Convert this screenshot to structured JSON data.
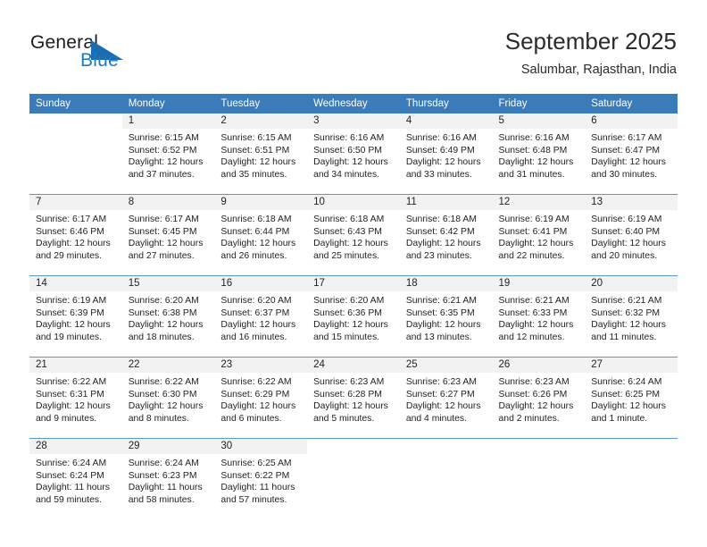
{
  "brand": {
    "word1": "General",
    "word2": "Blue",
    "accent_color": "#1b6cb3",
    "blue_text_color": "#1f7ac0"
  },
  "header": {
    "title": "September 2025",
    "subtitle": "Salumbar, Rajasthan, India"
  },
  "calendar": {
    "header_bg": "#3a7cba",
    "daynum_bg": "#f2f2f2",
    "weekday_headers": [
      "Sunday",
      "Monday",
      "Tuesday",
      "Wednesday",
      "Thursday",
      "Friday",
      "Saturday"
    ],
    "weeks": [
      [
        {
          "day": "",
          "sunrise": "",
          "sunset": "",
          "daylight1": "",
          "daylight2": ""
        },
        {
          "day": "1",
          "sunrise": "Sunrise: 6:15 AM",
          "sunset": "Sunset: 6:52 PM",
          "daylight1": "Daylight: 12 hours",
          "daylight2": "and 37 minutes."
        },
        {
          "day": "2",
          "sunrise": "Sunrise: 6:15 AM",
          "sunset": "Sunset: 6:51 PM",
          "daylight1": "Daylight: 12 hours",
          "daylight2": "and 35 minutes."
        },
        {
          "day": "3",
          "sunrise": "Sunrise: 6:16 AM",
          "sunset": "Sunset: 6:50 PM",
          "daylight1": "Daylight: 12 hours",
          "daylight2": "and 34 minutes."
        },
        {
          "day": "4",
          "sunrise": "Sunrise: 6:16 AM",
          "sunset": "Sunset: 6:49 PM",
          "daylight1": "Daylight: 12 hours",
          "daylight2": "and 33 minutes."
        },
        {
          "day": "5",
          "sunrise": "Sunrise: 6:16 AM",
          "sunset": "Sunset: 6:48 PM",
          "daylight1": "Daylight: 12 hours",
          "daylight2": "and 31 minutes."
        },
        {
          "day": "6",
          "sunrise": "Sunrise: 6:17 AM",
          "sunset": "Sunset: 6:47 PM",
          "daylight1": "Daylight: 12 hours",
          "daylight2": "and 30 minutes."
        }
      ],
      [
        {
          "day": "7",
          "sunrise": "Sunrise: 6:17 AM",
          "sunset": "Sunset: 6:46 PM",
          "daylight1": "Daylight: 12 hours",
          "daylight2": "and 29 minutes."
        },
        {
          "day": "8",
          "sunrise": "Sunrise: 6:17 AM",
          "sunset": "Sunset: 6:45 PM",
          "daylight1": "Daylight: 12 hours",
          "daylight2": "and 27 minutes."
        },
        {
          "day": "9",
          "sunrise": "Sunrise: 6:18 AM",
          "sunset": "Sunset: 6:44 PM",
          "daylight1": "Daylight: 12 hours",
          "daylight2": "and 26 minutes."
        },
        {
          "day": "10",
          "sunrise": "Sunrise: 6:18 AM",
          "sunset": "Sunset: 6:43 PM",
          "daylight1": "Daylight: 12 hours",
          "daylight2": "and 25 minutes."
        },
        {
          "day": "11",
          "sunrise": "Sunrise: 6:18 AM",
          "sunset": "Sunset: 6:42 PM",
          "daylight1": "Daylight: 12 hours",
          "daylight2": "and 23 minutes."
        },
        {
          "day": "12",
          "sunrise": "Sunrise: 6:19 AM",
          "sunset": "Sunset: 6:41 PM",
          "daylight1": "Daylight: 12 hours",
          "daylight2": "and 22 minutes."
        },
        {
          "day": "13",
          "sunrise": "Sunrise: 6:19 AM",
          "sunset": "Sunset: 6:40 PM",
          "daylight1": "Daylight: 12 hours",
          "daylight2": "and 20 minutes."
        }
      ],
      [
        {
          "day": "14",
          "sunrise": "Sunrise: 6:19 AM",
          "sunset": "Sunset: 6:39 PM",
          "daylight1": "Daylight: 12 hours",
          "daylight2": "and 19 minutes."
        },
        {
          "day": "15",
          "sunrise": "Sunrise: 6:20 AM",
          "sunset": "Sunset: 6:38 PM",
          "daylight1": "Daylight: 12 hours",
          "daylight2": "and 18 minutes."
        },
        {
          "day": "16",
          "sunrise": "Sunrise: 6:20 AM",
          "sunset": "Sunset: 6:37 PM",
          "daylight1": "Daylight: 12 hours",
          "daylight2": "and 16 minutes."
        },
        {
          "day": "17",
          "sunrise": "Sunrise: 6:20 AM",
          "sunset": "Sunset: 6:36 PM",
          "daylight1": "Daylight: 12 hours",
          "daylight2": "and 15 minutes."
        },
        {
          "day": "18",
          "sunrise": "Sunrise: 6:21 AM",
          "sunset": "Sunset: 6:35 PM",
          "daylight1": "Daylight: 12 hours",
          "daylight2": "and 13 minutes."
        },
        {
          "day": "19",
          "sunrise": "Sunrise: 6:21 AM",
          "sunset": "Sunset: 6:33 PM",
          "daylight1": "Daylight: 12 hours",
          "daylight2": "and 12 minutes."
        },
        {
          "day": "20",
          "sunrise": "Sunrise: 6:21 AM",
          "sunset": "Sunset: 6:32 PM",
          "daylight1": "Daylight: 12 hours",
          "daylight2": "and 11 minutes."
        }
      ],
      [
        {
          "day": "21",
          "sunrise": "Sunrise: 6:22 AM",
          "sunset": "Sunset: 6:31 PM",
          "daylight1": "Daylight: 12 hours",
          "daylight2": "and 9 minutes."
        },
        {
          "day": "22",
          "sunrise": "Sunrise: 6:22 AM",
          "sunset": "Sunset: 6:30 PM",
          "daylight1": "Daylight: 12 hours",
          "daylight2": "and 8 minutes."
        },
        {
          "day": "23",
          "sunrise": "Sunrise: 6:22 AM",
          "sunset": "Sunset: 6:29 PM",
          "daylight1": "Daylight: 12 hours",
          "daylight2": "and 6 minutes."
        },
        {
          "day": "24",
          "sunrise": "Sunrise: 6:23 AM",
          "sunset": "Sunset: 6:28 PM",
          "daylight1": "Daylight: 12 hours",
          "daylight2": "and 5 minutes."
        },
        {
          "day": "25",
          "sunrise": "Sunrise: 6:23 AM",
          "sunset": "Sunset: 6:27 PM",
          "daylight1": "Daylight: 12 hours",
          "daylight2": "and 4 minutes."
        },
        {
          "day": "26",
          "sunrise": "Sunrise: 6:23 AM",
          "sunset": "Sunset: 6:26 PM",
          "daylight1": "Daylight: 12 hours",
          "daylight2": "and 2 minutes."
        },
        {
          "day": "27",
          "sunrise": "Sunrise: 6:24 AM",
          "sunset": "Sunset: 6:25 PM",
          "daylight1": "Daylight: 12 hours",
          "daylight2": "and 1 minute."
        }
      ],
      [
        {
          "day": "28",
          "sunrise": "Sunrise: 6:24 AM",
          "sunset": "Sunset: 6:24 PM",
          "daylight1": "Daylight: 11 hours",
          "daylight2": "and 59 minutes."
        },
        {
          "day": "29",
          "sunrise": "Sunrise: 6:24 AM",
          "sunset": "Sunset: 6:23 PM",
          "daylight1": "Daylight: 11 hours",
          "daylight2": "and 58 minutes."
        },
        {
          "day": "30",
          "sunrise": "Sunrise: 6:25 AM",
          "sunset": "Sunset: 6:22 PM",
          "daylight1": "Daylight: 11 hours",
          "daylight2": "and 57 minutes."
        },
        {
          "day": "",
          "sunrise": "",
          "sunset": "",
          "daylight1": "",
          "daylight2": ""
        },
        {
          "day": "",
          "sunrise": "",
          "sunset": "",
          "daylight1": "",
          "daylight2": ""
        },
        {
          "day": "",
          "sunrise": "",
          "sunset": "",
          "daylight1": "",
          "daylight2": ""
        },
        {
          "day": "",
          "sunrise": "",
          "sunset": "",
          "daylight1": "",
          "daylight2": ""
        }
      ]
    ]
  }
}
